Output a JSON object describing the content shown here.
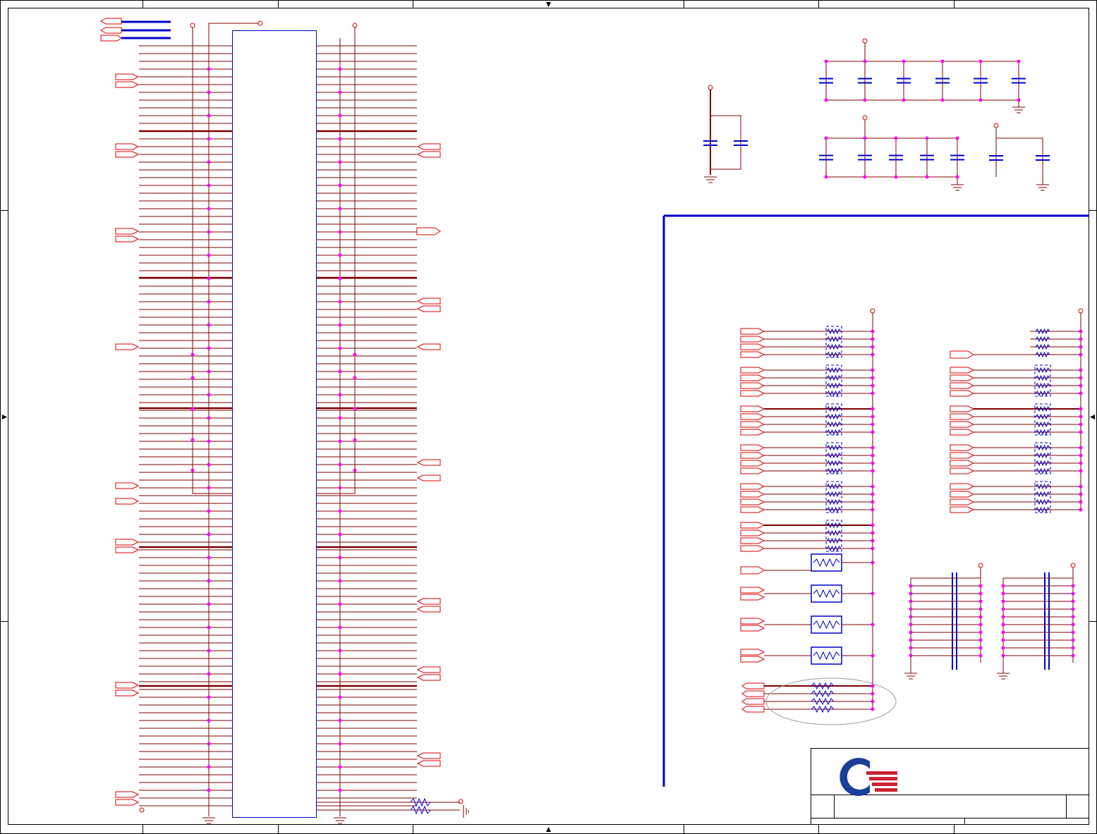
{
  "sheet": {
    "kind": "schematic-sheet",
    "zones": 8,
    "rows": 4,
    "colors": {
      "wire": "#800000",
      "bus": "#0000cc",
      "component": "#0000cc",
      "port": "#dd0000",
      "junction": "#ff00ff",
      "frame": "#000000"
    }
  },
  "title_block": {
    "logo": "red-blue-q-logo"
  },
  "connector": {
    "left_pin_rows": 100,
    "right_pin_rows": 100
  }
}
